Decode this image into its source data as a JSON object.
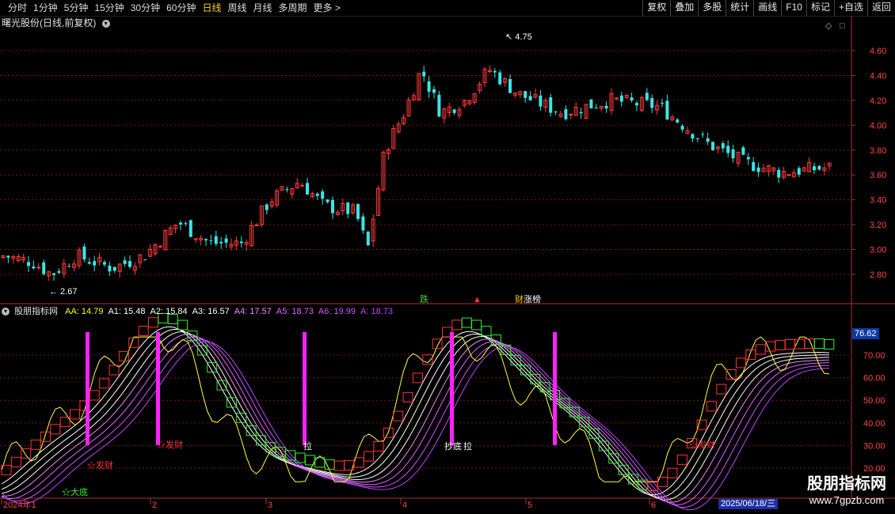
{
  "toolbar": {
    "periods": [
      "分时",
      "1分钟",
      "5分钟",
      "15分钟",
      "30分钟",
      "60分钟",
      "日线",
      "周线",
      "月线",
      "多周期",
      "更多 >"
    ],
    "active_period": "日线",
    "actions": [
      "复权",
      "叠加",
      "多股",
      "统计",
      "画线",
      "F10",
      "标记",
      "+自选",
      "返回"
    ]
  },
  "stock": {
    "title": "曙光股份(日线,前复权)",
    "high_label": "4.75",
    "low_label": "2.67",
    "markers": [
      "跌",
      "▲",
      "财",
      "涨榜"
    ]
  },
  "price_axis": {
    "ticks": [
      "4.60",
      "4.40",
      "4.20",
      "4.00",
      "3.80",
      "3.60",
      "3.40",
      "3.20",
      "3.00",
      "2.80"
    ]
  },
  "indicator": {
    "name": "股朋指标网",
    "values": [
      {
        "label": "AA: 14.79",
        "color": "#ffff00"
      },
      {
        "label": "A1: 15.48",
        "color": "#ffffff"
      },
      {
        "label": "A2: 15.84",
        "color": "#ffffff"
      },
      {
        "label": "A3: 16.57",
        "color": "#ffffff"
      },
      {
        "label": "A4: 17.57",
        "color": "#ee88ff"
      },
      {
        "label": "A5: 18.73",
        "color": "#dd66ff"
      },
      {
        "label": "A6: 19.99",
        "color": "#cc55ff"
      },
      {
        "label": "A: 18.73",
        "color": "#bb44ff"
      }
    ],
    "axis_ticks": [
      "70.00",
      "60.00",
      "50.00",
      "40.00",
      "30.00",
      "20.00"
    ],
    "current_value": "76.62",
    "annotations": [
      "☆大底",
      "☆发财",
      "☆发财",
      "拉",
      "抄底",
      "拉",
      "☆发财"
    ]
  },
  "time_axis": {
    "labels": [
      "2024年1",
      "2",
      "3",
      "4",
      "5",
      "6"
    ],
    "current_date": "2025/06/18/三"
  },
  "watermark": {
    "line1": "股朋指标网",
    "line2": "www.7gpzb.com"
  },
  "colors": {
    "up": "#ff3a3a",
    "down": "#39e6e6",
    "green_box": "#33ee33",
    "magenta": "#ff22ff",
    "yellow": "#ffff44"
  }
}
